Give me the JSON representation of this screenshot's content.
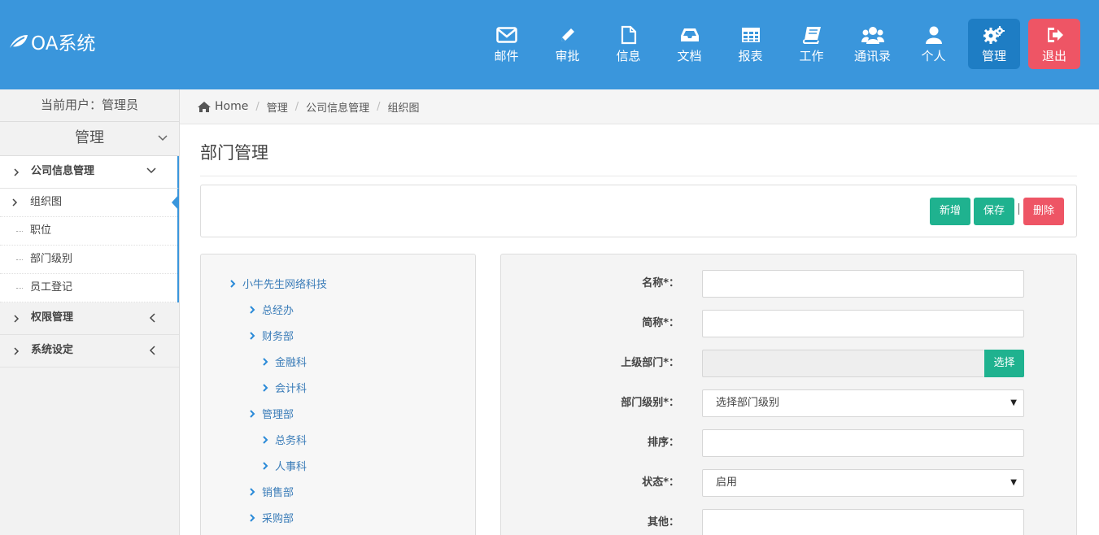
{
  "header": {
    "logo_text": "OA系统",
    "nav": [
      {
        "label": "邮件",
        "icon": "envelope-icon"
      },
      {
        "label": "审批",
        "icon": "pencil-icon"
      },
      {
        "label": "信息",
        "icon": "file-icon"
      },
      {
        "label": "文档",
        "icon": "inbox-icon"
      },
      {
        "label": "报表",
        "icon": "table-icon"
      },
      {
        "label": "工作",
        "icon": "book-icon"
      },
      {
        "label": "通讯录",
        "icon": "users-icon"
      },
      {
        "label": "个人",
        "icon": "user-icon"
      },
      {
        "label": "管理",
        "icon": "gears-icon",
        "active": true
      },
      {
        "label": "退出",
        "icon": "sign-out-icon"
      }
    ]
  },
  "sidebar": {
    "current_user": "当前用户：管理员",
    "section_title": "管理",
    "menus": [
      {
        "label": "公司信息管理",
        "open": true,
        "children": [
          {
            "label": "组织图",
            "active": true
          },
          {
            "label": "职位"
          },
          {
            "label": "部门级别"
          },
          {
            "label": "员工登记"
          }
        ]
      },
      {
        "label": "权限管理"
      },
      {
        "label": "系统设定"
      }
    ]
  },
  "breadcrumb": {
    "home": "Home",
    "items": [
      "管理",
      "公司信息管理",
      "组织图"
    ]
  },
  "page": {
    "title": "部门管理",
    "buttons": {
      "add": "新增",
      "save": "保存",
      "delete": "删除"
    }
  },
  "tree": [
    {
      "label": "小牛先生网络科技",
      "level": 0
    },
    {
      "label": "总经办",
      "level": 1
    },
    {
      "label": "财务部",
      "level": 1
    },
    {
      "label": "金融科",
      "level": 2
    },
    {
      "label": "会计科",
      "level": 2
    },
    {
      "label": "管理部",
      "level": 1
    },
    {
      "label": "总务科",
      "level": 2
    },
    {
      "label": "人事科",
      "level": 2
    },
    {
      "label": "销售部",
      "level": 1
    },
    {
      "label": "采购部",
      "level": 1
    }
  ],
  "form": {
    "name_label": "名称*：",
    "name_value": "",
    "short_label": "简称*：",
    "short_value": "",
    "parent_label": "上级部门*：",
    "parent_value": "",
    "choose_button": "选择",
    "level_label": "部门级别*：",
    "level_value": "选择部门级别",
    "order_label": "排序：",
    "order_value": "",
    "status_label": "状态*：",
    "status_value": "启用",
    "other_label": "其他：",
    "other_value": ""
  },
  "colors": {
    "header_bg": "#3a96dc",
    "active_nav": "#1e7dc4",
    "logout": "#ee5565",
    "success": "#1fb28f",
    "danger": "#ee5565"
  }
}
